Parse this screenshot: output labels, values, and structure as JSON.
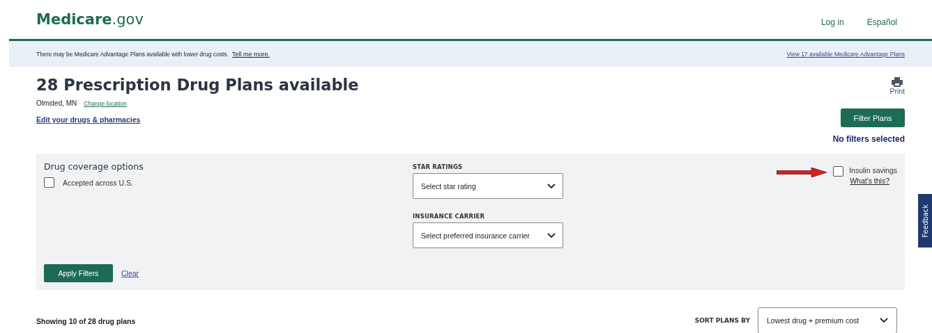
{
  "header": {
    "logo": {
      "brand": "Medicare",
      "suffix": ".gov"
    },
    "links": [
      "Log in",
      "Español"
    ]
  },
  "banner": {
    "text": "There may be Medicare Advantage Plans available with lower drug costs.",
    "link": "Tell me more.",
    "right_link": "View 17 available Medicare Advantage Plans"
  },
  "heading": "28 Prescription Drug Plans available",
  "location": "Olmsted, MN",
  "change_location": "Change location",
  "edit_link": "Edit your drugs & pharmacies",
  "print": "Print",
  "filter_button": "Filter Plans",
  "filter_status": "No filters selected",
  "filters": {
    "drug_coverage": {
      "title": "Drug coverage options",
      "options": [
        {
          "label": "Accepted across U.S.",
          "checked": false
        }
      ]
    },
    "dropdowns": [
      {
        "label": "STAR RATINGS",
        "value": "Select star rating"
      },
      {
        "label": "INSURANCE CARRIER",
        "value": "Select preferred insurance carrier"
      }
    ],
    "insulin": {
      "label": "Insulin savings",
      "checked": false,
      "help_link": "What's this?"
    },
    "apply": "Apply Filters",
    "clear": "Clear"
  },
  "results": {
    "summary": "Showing 10 of 28 drug plans",
    "sort_label": "SORT PLANS BY",
    "sort_value": "Lowest drug + premium cost"
  },
  "feedback": "Feedback"
}
